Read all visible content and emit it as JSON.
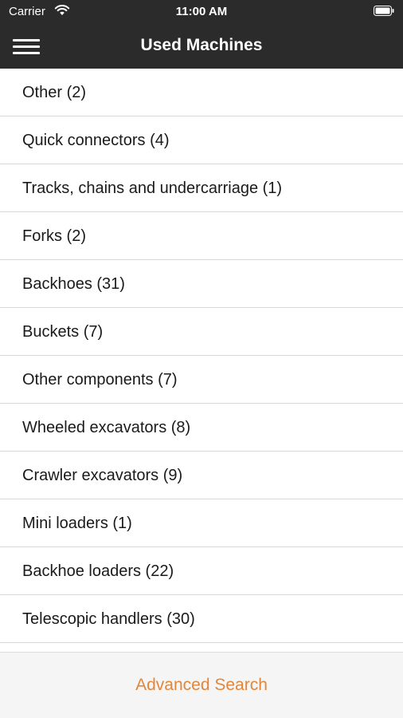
{
  "status_bar": {
    "carrier": "Carrier",
    "time": "11:00 AM",
    "wifi_icon": "wifi-icon",
    "battery_icon": "battery-icon"
  },
  "nav": {
    "title": "Used Machines",
    "menu_icon": "hamburger-menu-icon"
  },
  "categories": [
    "Other (2)",
    "Quick connectors (4)",
    "Tracks, chains and undercarriage (1)",
    "Forks (2)",
    "Backhoes (31)",
    "Buckets (7)",
    "Other components (7)",
    "Wheeled excavators (8)",
    "Crawler excavators (9)",
    "Mini loaders (1)",
    "Backhoe loaders (22)",
    "Telescopic handlers (30)"
  ],
  "bottom": {
    "advanced_search_label": "Advanced Search"
  },
  "colors": {
    "header_bg": "#2b2b2b",
    "accent": "#e2863a",
    "bottom_bg": "#f5f5f5"
  }
}
